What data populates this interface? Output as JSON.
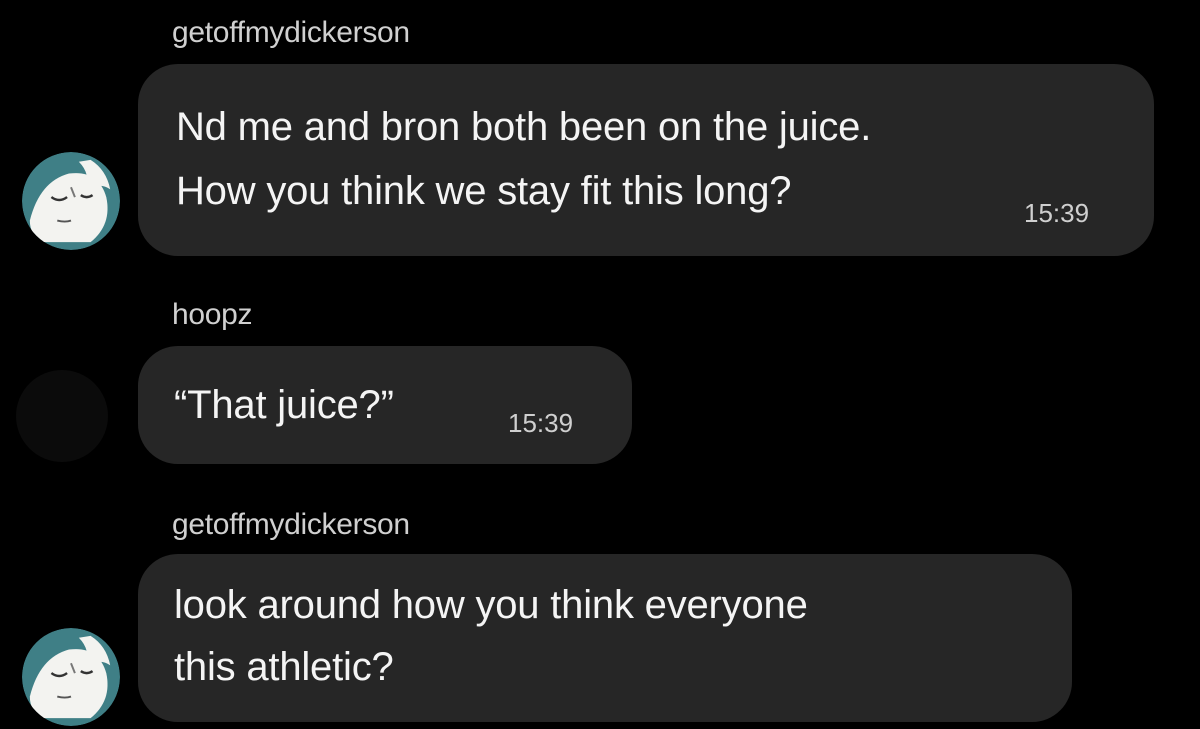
{
  "conversation": {
    "messages": [
      {
        "sender": "getoffmydickerson",
        "lines": [
          "Nd me and bron both been on the juice.",
          "How you think we stay fit this long?"
        ],
        "time": "15:39",
        "avatar": "cartoon-face-avatar"
      },
      {
        "sender": "hoopz",
        "lines": [
          "“That juice?”"
        ],
        "time": "15:39",
        "avatar": "dark-avatar"
      },
      {
        "sender": "getoffmydickerson",
        "lines": [
          "look around how you think everyone",
          "this athletic?"
        ],
        "time": "",
        "avatar": "cartoon-face-avatar"
      }
    ]
  },
  "colors": {
    "background": "#000000",
    "bubble": "#262626",
    "text": "#f4f4f4",
    "meta": "#cfcfcf",
    "avatar_teal": "#3f7f86"
  }
}
